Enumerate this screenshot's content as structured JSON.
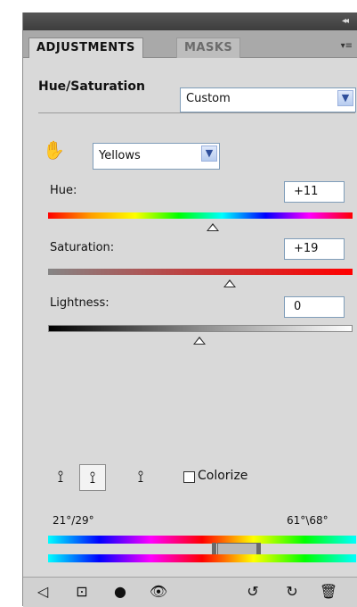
{
  "panel": {
    "tabs": [
      "ADJUSTMENTS",
      "MASKS"
    ],
    "collapse_glyph": "◂◂",
    "menu_glyph": "▾≡"
  },
  "adjustment": {
    "title": "Hue/Saturation",
    "preset": "Custom",
    "channel": "Yellows"
  },
  "controls": {
    "hue": {
      "label": "Hue:",
      "value": "+11"
    },
    "saturation": {
      "label": "Saturation:",
      "value": "+19"
    },
    "lightness": {
      "label": "Lightness:",
      "value": "0"
    }
  },
  "colorize": {
    "label": "Colorize",
    "checked": false
  },
  "range": {
    "left": "21°/29°",
    "right": "61°\\68°"
  },
  "icons": {
    "hand": "✋",
    "eyedropper": "⟟",
    "eyedropper_add": "⟟",
    "eyedropper_subtract": "⟟",
    "back": "◁",
    "fit": "⊡",
    "circle": "●",
    "eye": "👁",
    "prev": "↺",
    "reset": "↻",
    "trash": "🗑"
  }
}
